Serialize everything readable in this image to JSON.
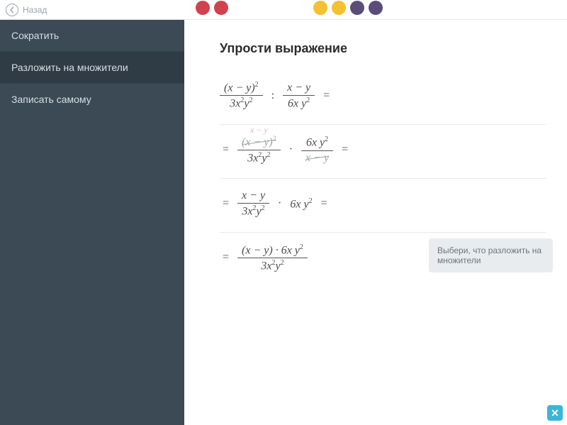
{
  "topbar": {
    "back_label": "Назад"
  },
  "dots": {
    "left": [
      "red",
      "red"
    ],
    "right": [
      "yellow",
      "yellow",
      "purple",
      "purple"
    ]
  },
  "sidebar": {
    "items": [
      {
        "label": "Сократить",
        "selected": false
      },
      {
        "label": "Разложить на множители",
        "selected": true
      },
      {
        "label": "Записать самому",
        "selected": false
      }
    ]
  },
  "content": {
    "title": "Упрости выражение",
    "hint_text": "Выбери, что разложить на множители"
  },
  "math": {
    "step1": {
      "frac1_num": "(x − y)²",
      "frac1_den": "3x²y²",
      "op": ":",
      "frac2_num": "x − y",
      "frac2_den": "6xy²",
      "trail": "="
    },
    "step2": {
      "lead": "=",
      "ghost": "x − y",
      "frac1_num": "(x − y)²",
      "frac1_den": "3x²y²",
      "op": "·",
      "frac2_num": "6xy²",
      "frac2_den": "x − y",
      "trail": "="
    },
    "step3": {
      "lead": "=",
      "frac_num": "x − y",
      "frac_den": "3x²y²",
      "op": "·",
      "term": "6xy²",
      "trail": "="
    },
    "step4": {
      "lead": "=",
      "frac_num": "(x − y) · 6xy²",
      "frac_den": "3x²y²"
    }
  }
}
